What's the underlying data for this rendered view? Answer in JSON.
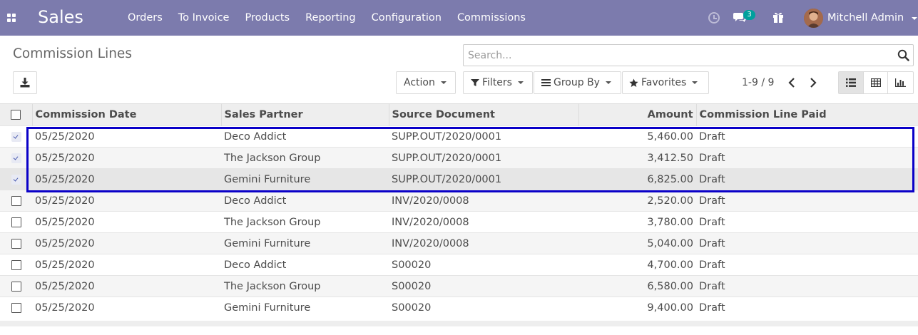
{
  "navbar": {
    "app_name": "Sales",
    "menu": [
      "Orders",
      "To Invoice",
      "Products",
      "Reporting",
      "Configuration",
      "Commissions"
    ],
    "message_count": "3",
    "user_name": "Mitchell Admin",
    "background": "#7c7bad"
  },
  "control_panel": {
    "title": "Commission Lines",
    "search_placeholder": "Search...",
    "action_label": "Action",
    "filters_label": "Filters",
    "groupby_label": "Group By",
    "favorites_label": "Favorites",
    "pager": "1-9 / 9"
  },
  "table": {
    "columns": [
      "Commission Date",
      "Sales Partner",
      "Source Document",
      "Amount",
      "Commission Line Paid"
    ],
    "rows": [
      {
        "selected": true,
        "date": "05/25/2020",
        "partner": "Deco Addict",
        "source": "SUPP.OUT/2020/0001",
        "amount": "5,460.00",
        "paid": "Draft"
      },
      {
        "selected": true,
        "date": "05/25/2020",
        "partner": "The Jackson Group",
        "source": "SUPP.OUT/2020/0001",
        "amount": "3,412.50",
        "paid": "Draft"
      },
      {
        "selected": true,
        "date": "05/25/2020",
        "partner": "Gemini Furniture",
        "source": "SUPP.OUT/2020/0001",
        "amount": "6,825.00",
        "paid": "Draft"
      },
      {
        "selected": false,
        "date": "05/25/2020",
        "partner": "Deco Addict",
        "source": "INV/2020/0008",
        "amount": "2,520.00",
        "paid": "Draft"
      },
      {
        "selected": false,
        "date": "05/25/2020",
        "partner": "The Jackson Group",
        "source": "INV/2020/0008",
        "amount": "3,780.00",
        "paid": "Draft"
      },
      {
        "selected": false,
        "date": "05/25/2020",
        "partner": "Gemini Furniture",
        "source": "INV/2020/0008",
        "amount": "5,040.00",
        "paid": "Draft"
      },
      {
        "selected": false,
        "date": "05/25/2020",
        "partner": "Deco Addict",
        "source": "S00020",
        "amount": "4,700.00",
        "paid": "Draft"
      },
      {
        "selected": false,
        "date": "05/25/2020",
        "partner": "The Jackson Group",
        "source": "S00020",
        "amount": "6,580.00",
        "paid": "Draft"
      },
      {
        "selected": false,
        "date": "05/25/2020",
        "partner": "Gemini Furniture",
        "source": "S00020",
        "amount": "9,400.00",
        "paid": "Draft"
      }
    ]
  },
  "colors": {
    "highlight_border": "#0a00c8",
    "badge": "#00a09d"
  }
}
